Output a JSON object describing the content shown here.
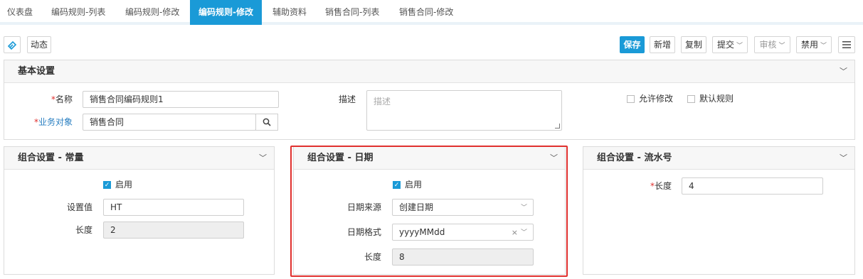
{
  "tabs": [
    {
      "label": "仪表盘"
    },
    {
      "label": "编码规则-列表"
    },
    {
      "label": "编码规则-修改"
    },
    {
      "label": "编码规则-修改"
    },
    {
      "label": "辅助资料"
    },
    {
      "label": "销售合同-列表"
    },
    {
      "label": "销售合同-修改"
    }
  ],
  "toolbar": {
    "dynamic_label": "动态",
    "save_label": "保存",
    "new_label": "新增",
    "copy_label": "复制",
    "submit_label": "提交",
    "audit_label": "审核",
    "disable_label": "禁用"
  },
  "basic": {
    "title": "基本设置",
    "name_label": "名称",
    "name_value": "销售合同编码规则1",
    "object_label": "业务对象",
    "object_value": "销售合同",
    "desc_label": "描述",
    "desc_placeholder": "描述",
    "allow_edit_label": "允许修改",
    "default_rule_label": "默认规则"
  },
  "constant": {
    "title": "组合设置 - 常量",
    "enable_label": "启用",
    "value_label": "设置值",
    "value": "HT",
    "length_label": "长度",
    "length": "2"
  },
  "date": {
    "title": "组合设置 - 日期",
    "enable_label": "启用",
    "source_label": "日期来源",
    "source_value": "创建日期",
    "format_label": "日期格式",
    "format_value": "yyyyMMdd",
    "length_label": "长度",
    "length": "8"
  },
  "serial": {
    "title": "组合设置 - 流水号",
    "length_label": "长度",
    "length": "4"
  },
  "colors": {
    "accent": "#1a9ad7",
    "highlight": "#e0302e"
  }
}
